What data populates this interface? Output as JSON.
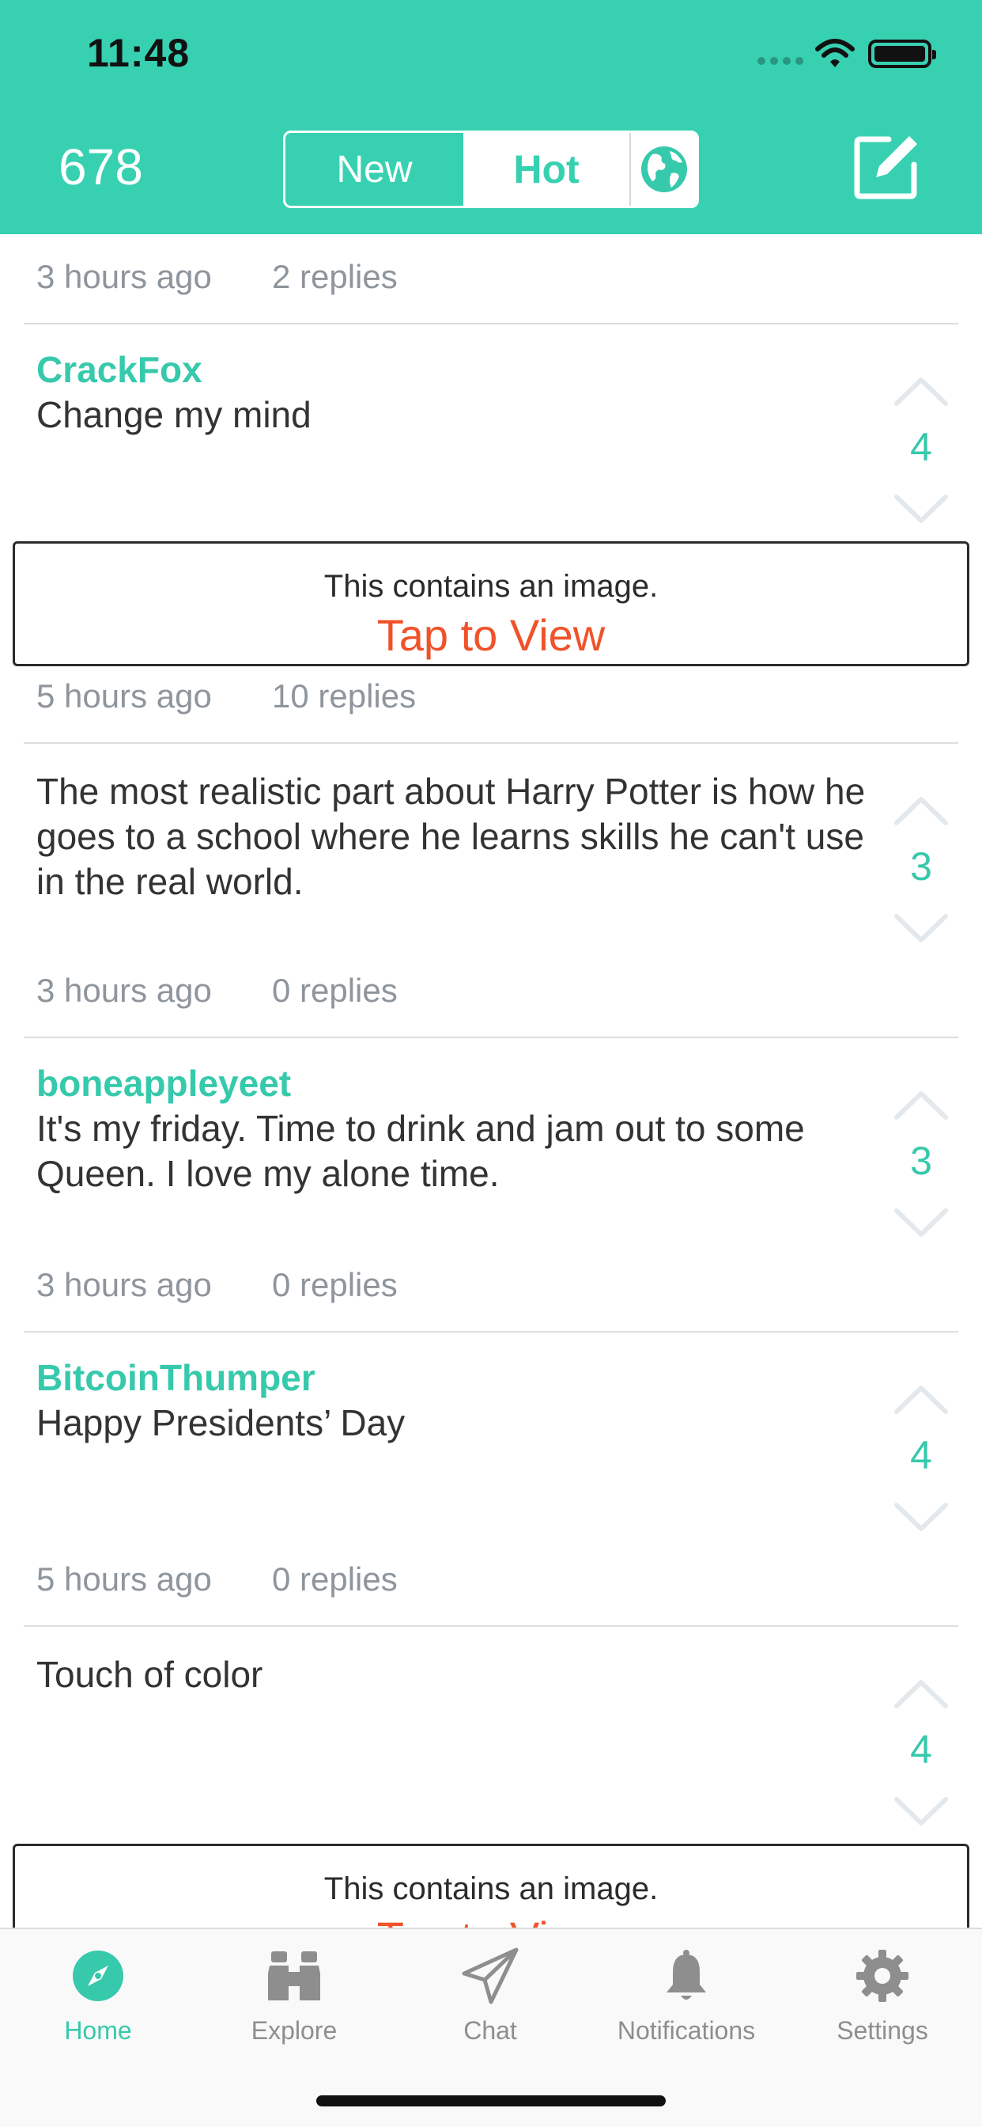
{
  "status_bar": {
    "time": "11:48"
  },
  "header": {
    "score": "678",
    "tabs": [
      {
        "label": "New",
        "selected": false
      },
      {
        "label": "Hot",
        "selected": true
      }
    ],
    "globe_icon": "globe-icon",
    "compose_icon": "compose-icon",
    "accent_color": "#37d1b1"
  },
  "feed": {
    "top_meta": {
      "time": "3 hours ago",
      "replies": "2 replies"
    },
    "posts": [
      {
        "author": "CrackFox",
        "text": "Change my mind",
        "votes": "4",
        "image": {
          "message": "This contains an image.",
          "action": "Tap to View"
        },
        "time": "5 hours ago",
        "replies": "10 replies"
      },
      {
        "author": "",
        "text": "The most realistic part about Harry Potter is how he goes to a school where he learns skills he can't use in the real world.",
        "votes": "3",
        "time": "3 hours ago",
        "replies": "0 replies"
      },
      {
        "author": "boneappleyeet",
        "text": "It's my friday. Time to drink and jam out to some Queen. I love my alone time.",
        "votes": "3",
        "time": "3 hours ago",
        "replies": "0 replies"
      },
      {
        "author": "BitcoinThumper",
        "text": "Happy Presidents’ Day",
        "votes": "4",
        "time": "5 hours ago",
        "replies": "0 replies"
      },
      {
        "author": "",
        "text": "Touch of color",
        "votes": "4",
        "image": {
          "message": "This contains an image.",
          "action": "Tap to View"
        }
      }
    ]
  },
  "tabbar": {
    "items": [
      {
        "label": "Home",
        "icon": "compass-icon",
        "active": true
      },
      {
        "label": "Explore",
        "icon": "binoculars-icon",
        "active": false
      },
      {
        "label": "Chat",
        "icon": "paper-plane-icon",
        "active": false
      },
      {
        "label": "Notifications",
        "icon": "bell-icon",
        "active": false
      },
      {
        "label": "Settings",
        "icon": "gear-icon",
        "active": false
      }
    ]
  }
}
